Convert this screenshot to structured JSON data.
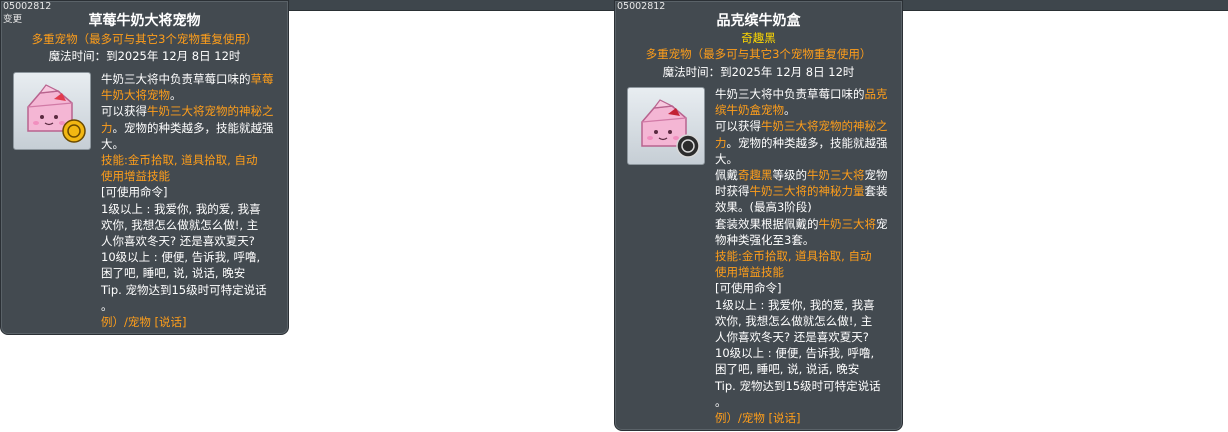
{
  "cards": [
    {
      "code": "05002812",
      "badge": "变更",
      "title": "草莓牛奶大将宠物",
      "multi": "多重宠物（最多可与其它3个宠物重复使用）",
      "magic_time": "魔法时间：到2025年 12月 8日 12时",
      "icon": "strawberry-milk-pet-icon",
      "desc": {
        "l1": "牛奶三大将中负责草莓口味的",
        "l1h": "草莓",
        "l2h": "牛奶大将宠物",
        "l2": "。",
        "l3": "可以获得",
        "l3h": "牛奶三大将宠物的神秘之",
        "l4h": "力",
        "l4": "。宠物的种类越多，技能就越强",
        "l5": "大。",
        "skill1": "技能:金币拾取, 道具拾取, 自动",
        "skill2": "使用增益技能",
        "cmd": "[可使用命令]",
        "c1": "1级以上 : 我爱你, 我的爱, 我喜",
        "c2": "欢你, 我想怎么做就怎么做!, 主",
        "c3": "人你喜欢冬天? 还是喜欢夏天?",
        "c4": "10级以上 : 便便, 告诉我, 呼噜,",
        "c5": "困了吧, 睡吧, 说, 说话, 晚安",
        "c6": "Tip. 宠物达到15级时可特定说话",
        "c7": "。",
        "example": "例）/宠物 [说话]"
      }
    },
    {
      "code": "05002812",
      "title": "品克缤牛奶盒",
      "set_name": "奇趣黑",
      "multi": "多重宠物（最多可与其它3个宠物重复使用）",
      "magic_time": "魔法时间：到2025年 12月 8日 12时",
      "icon": "pinkbean-milk-box-pet-icon",
      "desc": {
        "l1": "牛奶三大将中负责草莓口味的",
        "l1h": "品克",
        "l2h": "缤牛奶盒宠物",
        "l2": "。",
        "l3": "可以获得",
        "l3h": "牛奶三大将宠物的神秘之",
        "l4h": "力",
        "l4": "。宠物的种类越多，技能就越强",
        "l5": "大。",
        "s1a": "佩戴",
        "s1b": "奇趣黑",
        "s1c": "等级的",
        "s1d": "牛奶三大将",
        "s1e": "宠物",
        "s2a": "时获得",
        "s2b": "牛奶三大将的神秘力量",
        "s2c": "套装",
        "s3": "效果。(最高3阶段)",
        "s4a": "套装效果根据佩戴的",
        "s4b": "牛奶三大将",
        "s4c": "宠",
        "s5": "物种类强化至3套。",
        "skill1": "技能:金币拾取, 道具拾取, 自动",
        "skill2": "使用增益技能",
        "cmd": "[可使用命令]",
        "c1": "1级以上 : 我爱你, 我的爱, 我喜",
        "c2": "欢你, 我想怎么做就怎么做!, 主",
        "c3": "人你喜欢冬天? 还是喜欢夏天?",
        "c4": "10级以上 : 便便, 告诉我, 呼噜,",
        "c5": "困了吧, 睡吧, 说, 说话, 晚安",
        "c6": "Tip. 宠物达到15级时可特定说话",
        "c7": "。",
        "example": "例）/宠物 [说话]"
      }
    }
  ]
}
